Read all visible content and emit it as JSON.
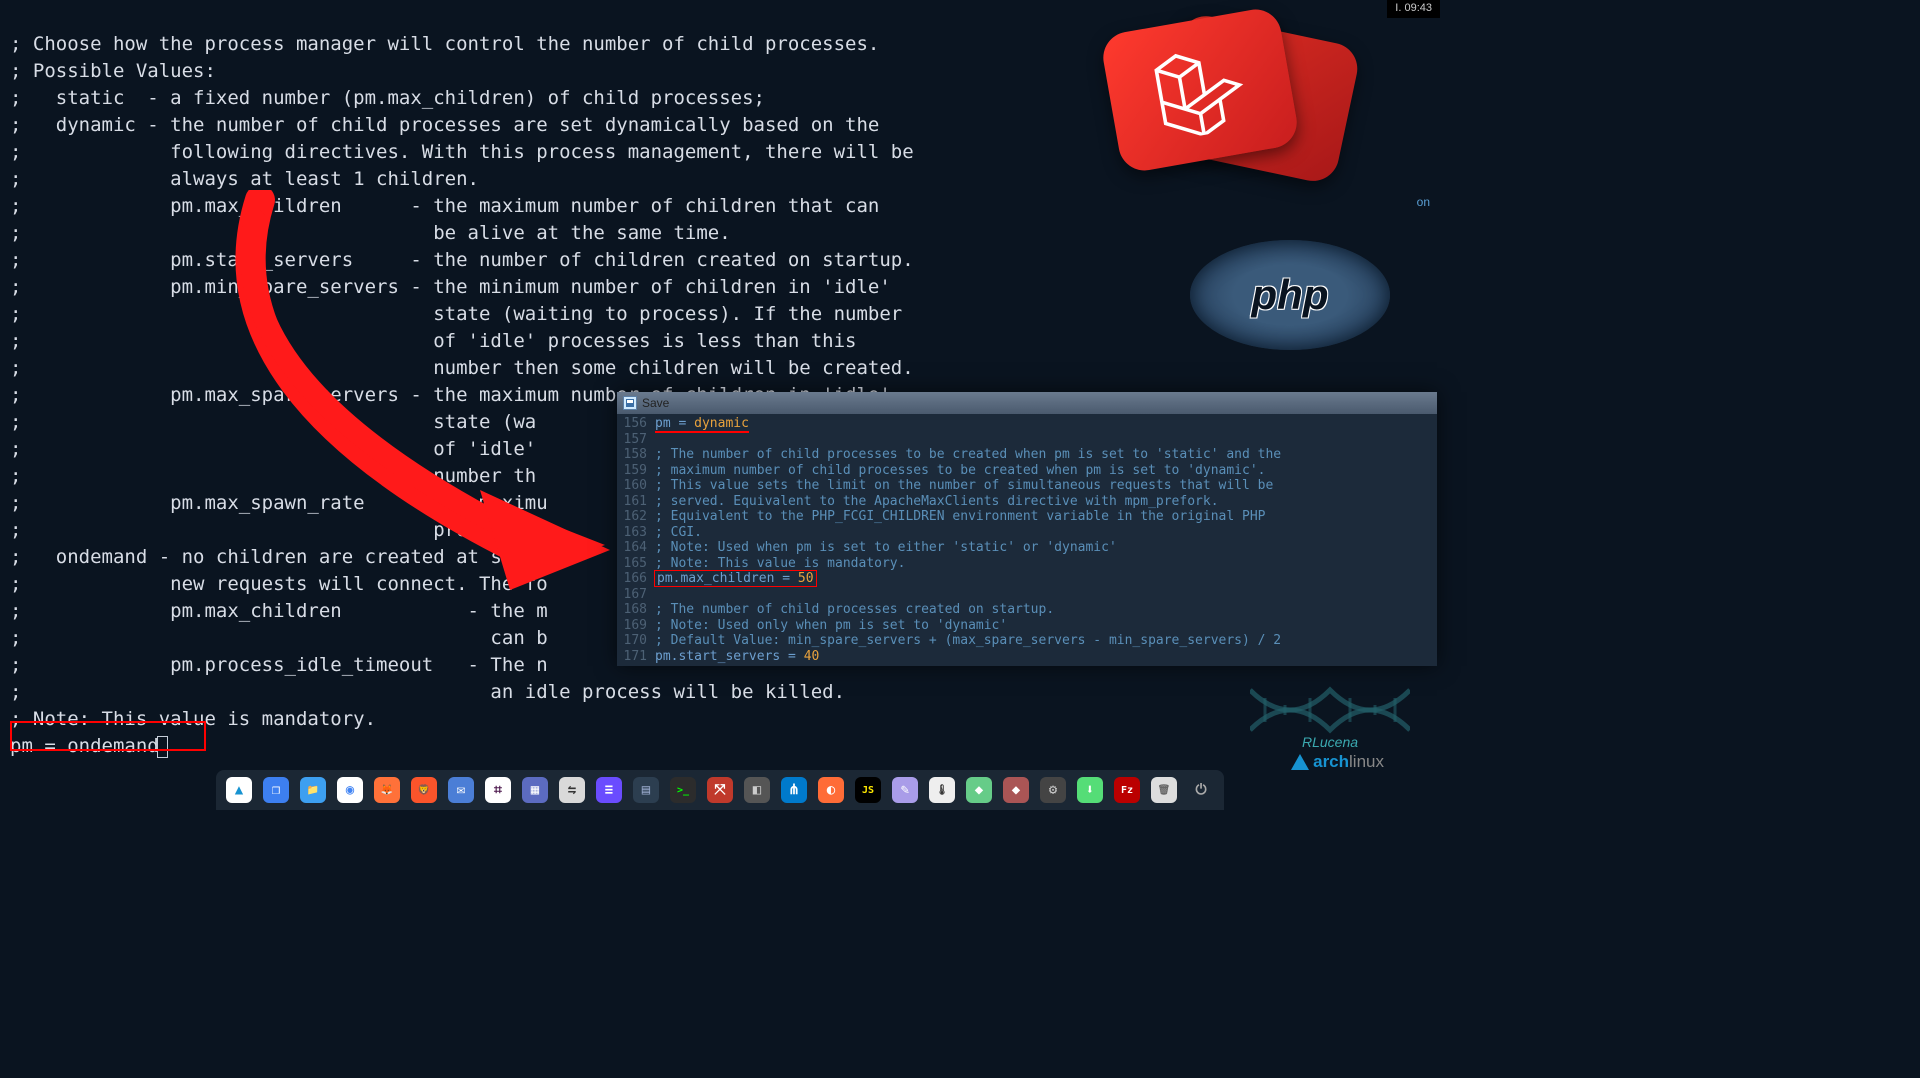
{
  "clock": "I. 09:43",
  "tiny_on": "on",
  "editor": {
    "l1": "; Choose how the process manager will control the number of child processes.",
    "l2": "; Possible Values:",
    "l3": ";   static  - a fixed number (pm.max_children) of child processes;",
    "l4": ";   dynamic - the number of child processes are set dynamically based on the",
    "l5": ";             following directives. With this process management, there will be",
    "l6": ";             always at least 1 children.",
    "l7": ";             pm.max_children      - the maximum number of children that can",
    "l8": ";                                    be alive at the same time.",
    "l9": ";             pm.start_servers     - the number of children created on startup.",
    "l10": ";             pm.min_spare_servers - the minimum number of children in 'idle'",
    "l11": ";                                    state (waiting to process). If the number",
    "l12": ";                                    of 'idle' processes is less than this",
    "l13": ";                                    number then some children will be created.",
    "l14": ";             pm.max_spare_servers - the maximum number of children in 'idle'",
    "l15": ";                                    state (wa",
    "l16": ";                                    of 'idle'",
    "l17": ";                                    number th",
    "l18": ";             pm.max_spawn_rate    - the maximu",
    "l19": ";                                    processes",
    "l20": ";   ondemand - no children are created at startu",
    "l21": ";             new requests will connect. The fo",
    "l22": ";             pm.max_children           - the m",
    "l23": ";                                         can b",
    "l24": ";             pm.process_idle_timeout   - The n",
    "l25": ";                                         an idle process will be killed.",
    "l26": "; Note: This value is mandatory.",
    "l27": "pm = ondemand"
  },
  "overlay": {
    "title": "Save",
    "lines": {
      "156": {
        "pm_key": "pm",
        "pm_eq": " = ",
        "pm_val": "dynamic"
      },
      "157": "",
      "158": "; The number of child processes to be created when pm is set to 'static' and the",
      "159": "; maximum number of child processes to be created when pm is set to 'dynamic'.",
      "160": "; This value sets the limit on the number of simultaneous requests that will be",
      "161": "; served. Equivalent to the ApacheMaxClients directive with mpm_prefork.",
      "162": "; Equivalent to the PHP_FCGI_CHILDREN environment variable in the original PHP",
      "163": "; CGI.",
      "164": "; Note: Used when pm is set to either 'static' or 'dynamic'",
      "165": "; Note: This value is mandatory.",
      "166": {
        "key": "pm.max_children",
        "eq": " = ",
        "val": "50"
      },
      "167": "",
      "168": "; The number of child processes created on startup.",
      "169": "; Note: Used only when pm is set to 'dynamic'",
      "170": "; Default Value: min_spare_servers + (max_spare_servers - min_spare_servers) / 2",
      "171": {
        "key": "pm.start_servers",
        "eq": " = ",
        "val": "40"
      }
    }
  },
  "php_text": "php",
  "dna_label": "RLucena",
  "arch": {
    "arch": "arch",
    "linux": "linux"
  },
  "taskbar_icons": [
    {
      "name": "arch-launcher",
      "bg": "#ffffff",
      "glyph": "▲",
      "fg": "#1793d1"
    },
    {
      "name": "workspace-icon",
      "bg": "#3d7ff0",
      "glyph": "❐",
      "fg": "#fff"
    },
    {
      "name": "files-icon",
      "bg": "#3d9ff0",
      "glyph": "📁",
      "fg": "#fff"
    },
    {
      "name": "chrome-icon",
      "bg": "#fff",
      "glyph": "◉",
      "fg": "#4285f4"
    },
    {
      "name": "firefox-icon",
      "bg": "#ff7139",
      "glyph": "🦊",
      "fg": "#fff"
    },
    {
      "name": "brave-icon",
      "bg": "#fb542b",
      "glyph": "🦁",
      "fg": "#fff"
    },
    {
      "name": "mail-icon",
      "bg": "#4b7ed6",
      "glyph": "✉",
      "fg": "#fff"
    },
    {
      "name": "slack-icon",
      "bg": "#fff",
      "glyph": "⌗",
      "fg": "#4a154b"
    },
    {
      "name": "grid-icon",
      "bg": "#5c6bc0",
      "glyph": "▦",
      "fg": "#fff"
    },
    {
      "name": "remmina-icon",
      "bg": "#d9d9d9",
      "glyph": "⇋",
      "fg": "#333"
    },
    {
      "name": "code-icon",
      "bg": "#6a4cff",
      "glyph": "≡",
      "fg": "#fff"
    },
    {
      "name": "monitor-icon1",
      "bg": "#2c3e50",
      "glyph": "▤",
      "fg": "#9ac"
    },
    {
      "name": "terminal-icon",
      "bg": "#2c2c2c",
      "glyph": ">_",
      "fg": "#0f0"
    },
    {
      "name": "network-icon",
      "bg": "#c0392b",
      "glyph": "⤧",
      "fg": "#fff"
    },
    {
      "name": "monitor-icon2",
      "bg": "#555",
      "glyph": "◧",
      "fg": "#ccc"
    },
    {
      "name": "vscode-icon",
      "bg": "#007acc",
      "glyph": "⋔",
      "fg": "#fff"
    },
    {
      "name": "postman-icon",
      "bg": "#ff6c37",
      "glyph": "◐",
      "fg": "#fff"
    },
    {
      "name": "jetbrains-icon",
      "bg": "#000",
      "glyph": "JS",
      "fg": "#ffe900"
    },
    {
      "name": "notes-icon",
      "bg": "#a99ce8",
      "glyph": "✎",
      "fg": "#fff"
    },
    {
      "name": "sensor-icon",
      "bg": "#eee",
      "glyph": "🌡",
      "fg": "#333"
    },
    {
      "name": "app-icon1",
      "bg": "#6c8",
      "glyph": "◆",
      "fg": "#fff"
    },
    {
      "name": "app-icon2",
      "bg": "#a55",
      "glyph": "◆",
      "fg": "#fff"
    },
    {
      "name": "settings-icon",
      "bg": "#444",
      "glyph": "⚙",
      "fg": "#ccc"
    },
    {
      "name": "download-icon",
      "bg": "#5d7",
      "glyph": "⬇",
      "fg": "#fff"
    },
    {
      "name": "filezilla-icon",
      "bg": "#b00",
      "glyph": "Fz",
      "fg": "#fff"
    },
    {
      "name": "trash-icon",
      "bg": "#ddd",
      "glyph": "🗑",
      "fg": "#666"
    },
    {
      "name": "power-icon",
      "bg": "transparent",
      "glyph": "⏻",
      "fg": "#aaa"
    }
  ]
}
